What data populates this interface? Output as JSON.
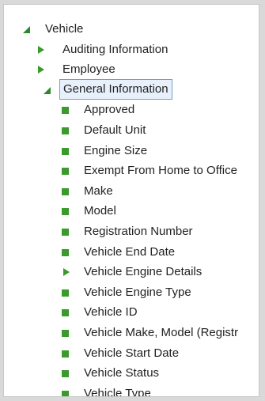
{
  "tree": {
    "root": {
      "label": "Vehicle",
      "state": "expanded"
    },
    "groups": [
      {
        "label": "Auditing Information",
        "state": "collapsed"
      },
      {
        "label": "Employee",
        "state": "collapsed"
      },
      {
        "label": "General Information",
        "state": "expanded",
        "selected": true
      }
    ],
    "children": [
      {
        "label": "Approved",
        "state": "leaf"
      },
      {
        "label": "Default Unit",
        "state": "leaf"
      },
      {
        "label": "Engine Size",
        "state": "leaf"
      },
      {
        "label": "Exempt From Home to Office",
        "state": "leaf"
      },
      {
        "label": "Make",
        "state": "leaf"
      },
      {
        "label": "Model",
        "state": "leaf"
      },
      {
        "label": "Registration Number",
        "state": "leaf"
      },
      {
        "label": "Vehicle End Date",
        "state": "leaf"
      },
      {
        "label": "Vehicle Engine Details",
        "state": "collapsed"
      },
      {
        "label": "Vehicle Engine Type",
        "state": "leaf"
      },
      {
        "label": "Vehicle ID",
        "state": "leaf"
      },
      {
        "label": "Vehicle Make, Model (Registr",
        "state": "leaf"
      },
      {
        "label": "Vehicle Start Date",
        "state": "leaf"
      },
      {
        "label": "Vehicle Status",
        "state": "leaf"
      },
      {
        "label": "Vehicle Type",
        "state": "leaf"
      }
    ]
  },
  "colors": {
    "icon_green": "#3a9a2c",
    "selection_border": "#6d9ecf",
    "selection_bg": "#e8f1fb"
  }
}
